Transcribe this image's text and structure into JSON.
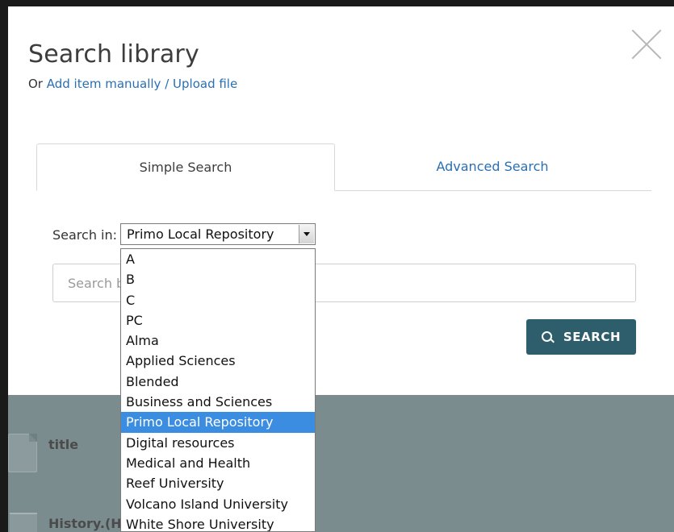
{
  "modal": {
    "title": "Search library",
    "subtitle_prefix": "Or ",
    "subtitle_link": "Add item manually / Upload file"
  },
  "tabs": [
    {
      "label": "Simple Search",
      "active": true
    },
    {
      "label": "Advanced Search",
      "active": false
    }
  ],
  "search_in": {
    "label": "Search in:",
    "selected": "Primo Local Repository",
    "options": [
      "A",
      "B",
      "C",
      "PC",
      "Alma",
      "Applied Sciences",
      "Blended",
      "Business and Sciences",
      "Primo Local Repository",
      "Digital resources",
      "Medical and Health",
      "Reef University",
      "Volcano Island University",
      "White Shore University"
    ],
    "highlighted_option": "Primo Local Repository"
  },
  "search_field": {
    "placeholder": "Search by",
    "value": ""
  },
  "search_button": {
    "label": "SEARCH",
    "icon": "search-icon"
  },
  "results": [
    {
      "title": "title",
      "icon": "document-icon"
    },
    {
      "title": "History.(H",
      "icon": "book-icon"
    }
  ],
  "colors": {
    "link": "#2a6fb2",
    "button_bg": "#2e5d6b",
    "results_overlay": "#7b8c8f",
    "selection": "#3a8de0"
  }
}
